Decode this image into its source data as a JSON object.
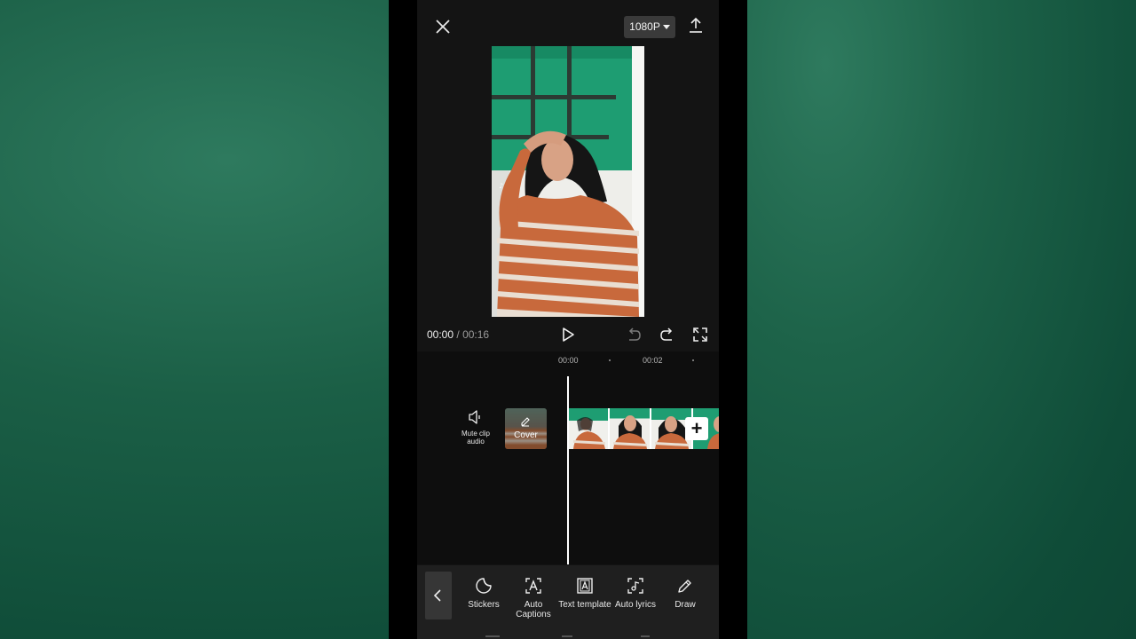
{
  "topbar": {
    "resolution": "1080P"
  },
  "player": {
    "current_time": "00:00",
    "separator": "/",
    "total_time": "00:16"
  },
  "timeline": {
    "ruler": [
      "00:00",
      "00:02"
    ],
    "mute_label": "Mute clip audio",
    "cover_label": "Cover"
  },
  "toolbar": {
    "items": [
      {
        "label": "Stickers",
        "icon": "sticker-icon"
      },
      {
        "label": "Auto Captions",
        "icon": "auto-captions-icon"
      },
      {
        "label": "Text template",
        "icon": "text-template-icon"
      },
      {
        "label": "Auto lyrics",
        "icon": "auto-lyrics-icon"
      },
      {
        "label": "Draw",
        "icon": "pencil-icon"
      }
    ]
  },
  "colors": {
    "accent": "#ffffff",
    "screen_bg": "#141414",
    "toolbar_bg": "#1f1f1f",
    "backdrop": "#0f4c38"
  }
}
